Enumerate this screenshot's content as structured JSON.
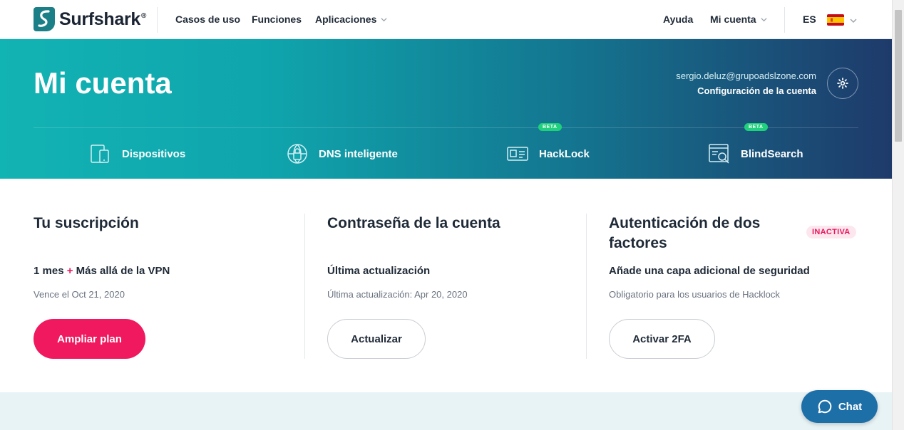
{
  "brand": {
    "name": "Surfshark",
    "reg": "®"
  },
  "nav": {
    "left": [
      {
        "label": "Casos de uso"
      },
      {
        "label": "Funciones"
      },
      {
        "label": "Aplicaciones",
        "dropdown": true
      }
    ],
    "help": "Ayuda",
    "account": "Mi cuenta",
    "language": "ES",
    "flag": "spain-flag-icon"
  },
  "hero": {
    "title": "Mi cuenta",
    "email": "sergio.deluz@grupoadslzone.com",
    "settings_link": "Configuración de la cuenta",
    "tabs": [
      {
        "label": "Dispositivos",
        "icon": "devices-icon"
      },
      {
        "label": "DNS inteligente",
        "icon": "dns-icon"
      },
      {
        "label": "HackLock",
        "icon": "id-card-icon",
        "badge": "BETA"
      },
      {
        "label": "BlindSearch",
        "icon": "search-window-icon",
        "badge": "BETA"
      }
    ]
  },
  "subscription": {
    "title": "Tu suscripción",
    "plan_a": "1 mes",
    "plus": "+",
    "plan_b": "Más allá de la VPN",
    "expires": "Vence el Oct 21, 2020",
    "button": "Ampliar plan"
  },
  "password": {
    "title": "Contraseña de la cuenta",
    "subtitle": "Última actualización",
    "meta": "Última actualización: Apr 20, 2020",
    "button": "Actualizar"
  },
  "twofa": {
    "title": "Autenticación de dos factores",
    "status": "INACTIVA",
    "subtitle": "Añade una capa adicional de seguridad",
    "meta": "Obligatorio para los usuarios de Hacklock",
    "button": "Activar 2FA"
  },
  "chat": {
    "label": "Chat"
  },
  "colors": {
    "accent": "#f0185e",
    "teal": "#12b3b3",
    "navy": "#1e3a6b",
    "beta": "#1fd07c",
    "chat": "#1d6fa8"
  }
}
